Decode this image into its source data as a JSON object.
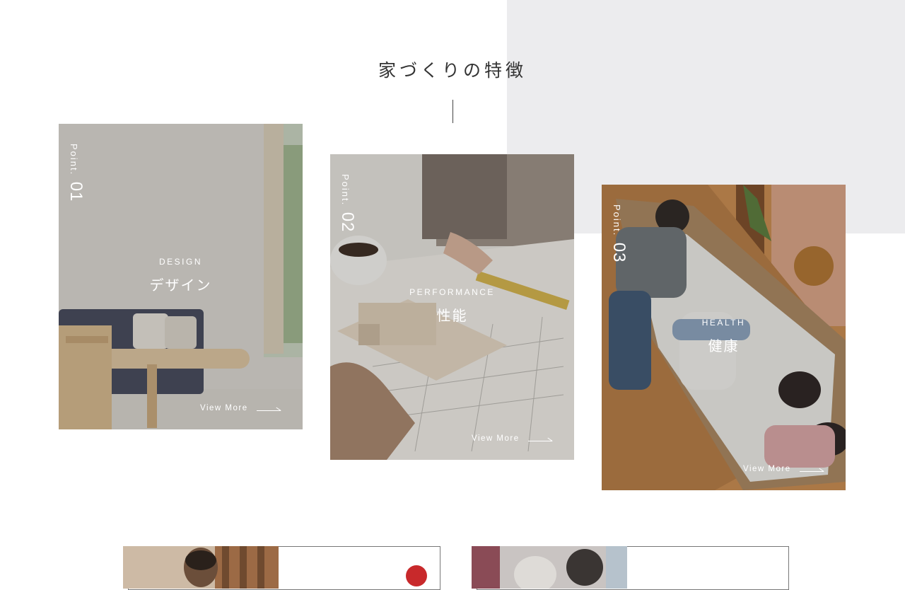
{
  "section": {
    "title": "家づくりの特徴"
  },
  "cards": [
    {
      "point_label": "Point.",
      "point_number": "01",
      "title_en": "DESIGN",
      "title_jp": "デザイン",
      "link_label": "View More"
    },
    {
      "point_label": "Point.",
      "point_number": "02",
      "title_en": "PERFORMANCE",
      "title_jp": "性能",
      "link_label": "View More"
    },
    {
      "point_label": "Point.",
      "point_number": "03",
      "title_en": "HEALTH",
      "title_jp": "健康",
      "link_label": "View More"
    }
  ],
  "colors": {
    "background": "#ffffff",
    "accent_panel": "#ececee",
    "text": "#333333",
    "badge": "#c8292b"
  },
  "icons": [
    "arrow-right-icon"
  ]
}
